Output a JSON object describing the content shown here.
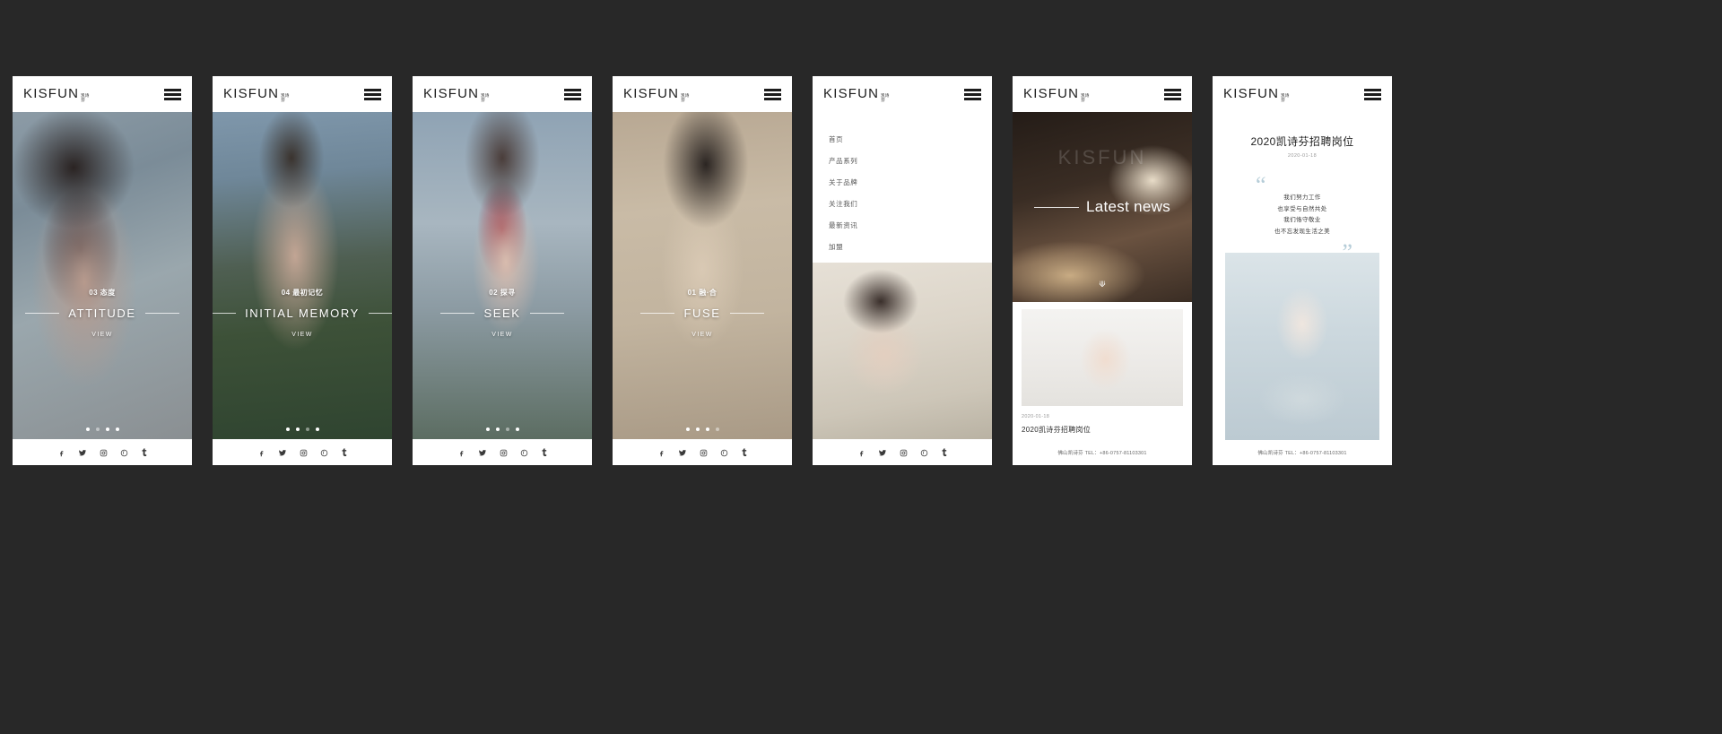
{
  "brand": {
    "logo_main": "KISFUN",
    "logo_sub_line1": "凯诗",
    "logo_sub_line2": "芬"
  },
  "menu_icon": "hamburger-menu-icon",
  "social": [
    {
      "name": "facebook-icon",
      "glyph": "f"
    },
    {
      "name": "twitter-icon",
      "glyph": "t"
    },
    {
      "name": "instagram-icon",
      "glyph": "i"
    },
    {
      "name": "pinterest-icon",
      "glyph": "p"
    },
    {
      "name": "tumblr-icon",
      "glyph": "t"
    }
  ],
  "slides": [
    {
      "cn": "03 态度",
      "en": "ATTITUDE",
      "view": "VIEW",
      "active_dot": 3,
      "dot_count": 4,
      "image": "woman-in-black-lingerie-by-window"
    },
    {
      "cn": "04 最初记忆",
      "en": "INITIAL MEMORY",
      "view": "VIEW",
      "active_dot": 4,
      "dot_count": 4,
      "image": "woman-on-mountain-with-blanket"
    },
    {
      "cn": "02 探寻",
      "en": "SEEK",
      "view": "VIEW",
      "active_dot": 2,
      "dot_count": 4,
      "image": "woman-in-red-lingerie-with-white-knit"
    },
    {
      "cn": "01 融·合",
      "en": "FUSE",
      "view": "VIEW",
      "active_dot": 1,
      "dot_count": 4,
      "image": "woman-in-navy-lingerie-on-sofa"
    }
  ],
  "nav_menu": {
    "items": [
      {
        "label": "首页"
      },
      {
        "label": "产品系列"
      },
      {
        "label": "关于品牌"
      },
      {
        "label": "关注我们"
      },
      {
        "label": "最新资讯"
      },
      {
        "label": "加盟"
      }
    ],
    "photo": "woman-reading-book-in-blue-lingerie"
  },
  "news": {
    "hero_title": "Latest news",
    "hero_ghost_text": "KISFUN",
    "hero_image": "runway-model-in-beige-dress",
    "scroll_arrow_icon": "chevron-down-icon",
    "thumb_image": "model-in-nude-lingerie-holding-flower",
    "date": "2020-01-18",
    "title": "2020凯诗芬招聘岗位",
    "footer": "佛山凯诗芬  TEL：+86-0757-81103301"
  },
  "detail": {
    "title": "2020凯诗芬招聘岗位",
    "date": "2020-01-18",
    "quote_open": "“",
    "quote_close": "”",
    "quote_lines": [
      "我们努力工作",
      "也享受与自然共处",
      "我们恪守敬业",
      "也不忘发现生活之美"
    ],
    "photo": "woman-with-white-flower-headpiece",
    "footer": "佛山凯诗芬  TEL：+86-0757-81103301"
  },
  "colors": {
    "page_background": "#282828",
    "card_background": "#ffffff",
    "text_dark": "#1c1c1c",
    "text_muted": "#9a9a9a",
    "quote_mark": "#b6cdd8"
  }
}
